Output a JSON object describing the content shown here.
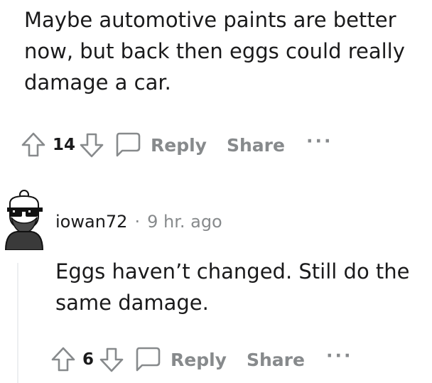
{
  "parent_comment": {
    "body_line1": "Maybe automotive paints are better",
    "body_line2": "now, but back then eggs could really",
    "body_line3": "damage a car.",
    "vote_count": "14",
    "reply_label": "Reply",
    "share_label": "Share",
    "more_label": "···"
  },
  "reply_comment": {
    "username": "iowan72",
    "separator": "·",
    "timestamp": "9 hr. ago",
    "body_line1": "Eggs haven’t changed. Still do the",
    "body_line2": "same damage.",
    "vote_count": "6",
    "reply_label": "Reply",
    "share_label": "Share",
    "more_label": "···"
  },
  "colors": {
    "text_primary": "#1a1a1b",
    "text_muted": "#878a8c",
    "icon_stroke": "#878a8c",
    "thread_line": "#edeff1"
  },
  "icons": {
    "upvote": "upvote-arrow-icon",
    "downvote": "downvote-arrow-icon",
    "reply": "speech-bubble-icon",
    "more": "ellipsis-icon"
  }
}
